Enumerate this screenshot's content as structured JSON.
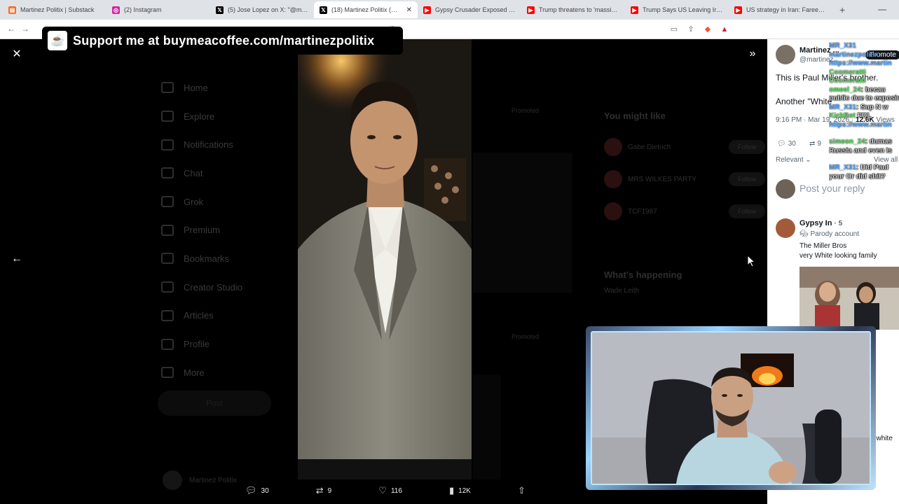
{
  "browser": {
    "tabs": [
      {
        "title": "Martinez Politix | Substack",
        "icon": "substack-icon",
        "color": "#ff6719",
        "active": false
      },
      {
        "title": "(2) Instagram",
        "icon": "instagram-icon",
        "color": "#d6249f",
        "active": false
      },
      {
        "title": "(5) Jose Lopez on X: \"@martine",
        "icon": "x-icon",
        "color": "#000000",
        "active": false
      },
      {
        "title": "(18) Martinez Politix (@ma",
        "icon": "x-icon",
        "color": "#000000",
        "active": true
      },
      {
        "title": "Gypsy Crusader Exposed Finall",
        "icon": "youtube-icon",
        "color": "#ff0000",
        "active": false
      },
      {
        "title": "Trump threatens to 'massively",
        "icon": "youtube-icon",
        "color": "#ff0000",
        "active": false
      },
      {
        "title": "Trump Says US Leaving Iran 'In",
        "icon": "youtube-icon",
        "color": "#ff0000",
        "active": false
      },
      {
        "title": "US strategy in Iran: Fareed's 'In",
        "icon": "youtube-icon",
        "color": "#ff0000",
        "active": false
      }
    ],
    "tab_close": "✕",
    "new_tab": "+",
    "url_fragment": "/2"
  },
  "banner": {
    "text": "Support me at buymeacoffee.com/martinezpolitix",
    "icon": "coffee-cup-icon"
  },
  "background_ui": {
    "nav_items": [
      "Home",
      "Explore",
      "Notifications",
      "Chat",
      "Grok",
      "Premium",
      "Bookmarks",
      "Creator Studio",
      "Articles",
      "Profile",
      "More"
    ],
    "post_button": "Post",
    "account_name": "Martinez Politix",
    "promoted_label": "Promoted",
    "you_might_like": "You might like",
    "suggestions": [
      {
        "name": "Gabe Dietrich"
      },
      {
        "name": "MRS WILKES PARTY"
      },
      {
        "name": "TCF1987"
      }
    ],
    "follow_label": "Follow",
    "whats_happening": "What's happening",
    "trend": "Wade Leith"
  },
  "viewer": {
    "close_icon": "close-icon",
    "expand_icon": "chevrons-right-icon",
    "back_icon": "arrow-left-icon",
    "stats": {
      "replies": "30",
      "reposts": "9",
      "likes": "116",
      "views": "12K"
    }
  },
  "tweet": {
    "author_name": "Martinez ...",
    "author_handle": "@martinez",
    "promote_label": "Promote",
    "line1": "This is Paul Miller's brother.",
    "line2": "Another \"White",
    "timestamp": "9:16 PM · Mar 19, 2026 ·",
    "views_count": "12.6K",
    "views_label": "Views",
    "reply_count": "30",
    "repost_count": "9",
    "sort_label": "Relevant",
    "view_all": "View all",
    "reply_placeholder": "Post your reply",
    "reply_author": "Gypsy In",
    "reply_time": "· 5",
    "parody_label": "Parody account",
    "reply_line1": "The Miller Bros",
    "reply_line2": "very White looking family",
    "right_edge_text": "t white"
  },
  "chat": [
    {
      "name": "MR_X31",
      "msg": ""
    },
    {
      "name": "",
      "msg": "martinezpolitix"
    },
    {
      "name": "",
      "msg": "https://www.martin"
    },
    {
      "name": "Coomeratti",
      "msg": ""
    },
    {
      "name": "Coomeratti",
      "msg": ""
    },
    {
      "name": "omeel_24",
      "msg": ": becau"
    },
    {
      "name": "",
      "msg": "public due to exposing"
    },
    {
      "name": "MR_X31",
      "msg": ": Sup N w"
    },
    {
      "name": "KickBot",
      "msg": "FOL"
    },
    {
      "name": "",
      "msg": "https://www.martin"
    },
    {
      "name": "simeon_24",
      "msg": ": dumas"
    },
    {
      "name": "",
      "msg": "Russia and even Is"
    },
    {
      "name": "MR_X31",
      "msg": ": Did Paul"
    },
    {
      "name": "",
      "msg": "your Or did shit?"
    }
  ]
}
